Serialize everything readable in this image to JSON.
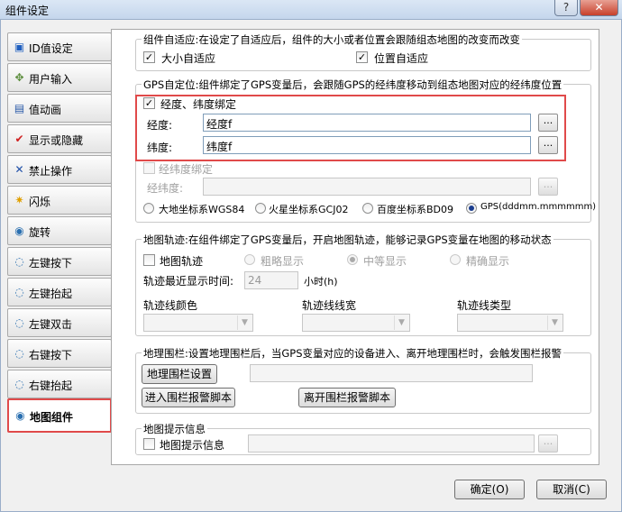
{
  "window": {
    "title": "组件设定",
    "help_glyph": "?",
    "close_glyph": "✕"
  },
  "sidebar": {
    "items": [
      {
        "label": "ID值设定",
        "icon": "id-icon"
      },
      {
        "label": "用户输入",
        "icon": "user-input-icon"
      },
      {
        "label": "值动画",
        "icon": "value-animation-icon"
      },
      {
        "label": "显示或隐藏",
        "icon": "visibility-check-icon"
      },
      {
        "label": "禁止操作",
        "icon": "forbid-icon"
      },
      {
        "label": "闪烁",
        "icon": "flash-icon"
      },
      {
        "label": "旋转",
        "icon": "rotate-icon"
      },
      {
        "label": "左键按下",
        "icon": "left-press-icon"
      },
      {
        "label": "左键抬起",
        "icon": "left-release-icon"
      },
      {
        "label": "左键双击",
        "icon": "left-doubleclick-icon"
      },
      {
        "label": "右键按下",
        "icon": "right-press-icon"
      },
      {
        "label": "右键抬起",
        "icon": "right-release-icon"
      },
      {
        "label": "地图组件",
        "icon": "map-component-icon",
        "active": true
      }
    ]
  },
  "adaptive": {
    "title": "组件自适应:在设定了自适应后，组件的大小或者位置会跟随组态地图的改变而改变",
    "size_label": "大小自适应",
    "size_checked": true,
    "pos_label": "位置自适应",
    "pos_checked": true
  },
  "gps": {
    "title": "GPS自定位:组件绑定了GPS变量后，会跟随GPS的经纬度移动到组态地图对应的经纬度位置",
    "bind_label": "经度、纬度绑定",
    "bind_checked": true,
    "lon_label": "经度:",
    "lon_value": "经度f",
    "lat_label": "纬度:",
    "lat_value": "纬度f",
    "combined_label": "经纬度绑定",
    "combined_checked": false,
    "combined_field_label": "经纬度:",
    "combined_value": "",
    "dots": "...",
    "coords": [
      {
        "label": "大地坐标系WGS84",
        "selected": false
      },
      {
        "label": "火星坐标系GCJ02",
        "selected": false
      },
      {
        "label": "百度坐标系BD09",
        "selected": false
      },
      {
        "label": "GPS(dddmm.mmmmmm)",
        "selected": true
      }
    ]
  },
  "track": {
    "title": "地图轨迹:在组件绑定了GPS变量后，开启地图轨迹，能够记录GPS变量在地图的移动状态",
    "enable_label": "地图轨迹",
    "enable_checked": false,
    "precision": [
      {
        "label": "粗略显示",
        "selected": false
      },
      {
        "label": "中等显示",
        "selected": true
      },
      {
        "label": "精确显示",
        "selected": false
      }
    ],
    "recent_label": "轨迹最近显示时间:",
    "recent_value": "24",
    "recent_unit": "小时(h)",
    "color_label": "轨迹线颜色",
    "width_label": "轨迹线线宽",
    "type_label": "轨迹线类型",
    "combo_arrow": "▼"
  },
  "fence": {
    "title": "地理围栏:设置地理围栏后，当GPS变量对应的设备进入、离开地理围栏时，会触发围栏报警",
    "settings_button": "地理围栏设置",
    "settings_value": "",
    "enter_button": "进入围栏报警脚本",
    "leave_button": "离开围栏报警脚本"
  },
  "hint": {
    "title": "地图提示信息",
    "label": "地图提示信息",
    "checked": false,
    "value": ""
  },
  "footer": {
    "ok": "确定(O)",
    "cancel": "取消(C)"
  },
  "check_glyph": "✓",
  "colors": {
    "highlight": "#e04a4a",
    "accent": "#1a3d8f"
  }
}
